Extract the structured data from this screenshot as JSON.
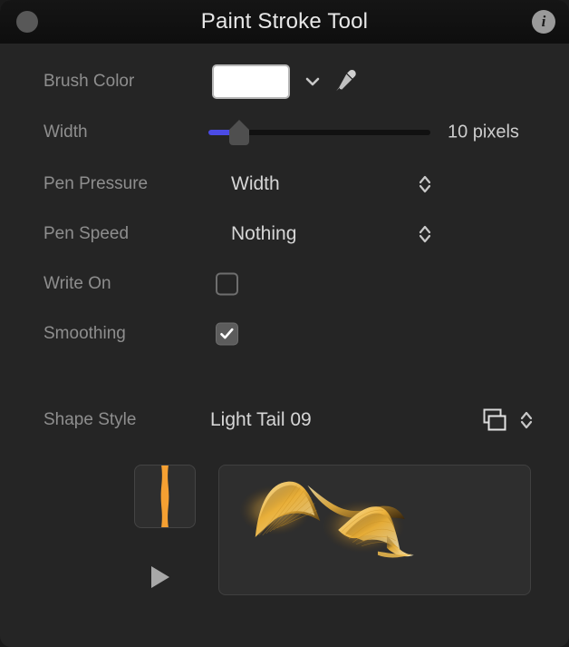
{
  "window": {
    "title": "Paint Stroke Tool",
    "close_label": "",
    "info_label": "i",
    "background_color": "#252525",
    "titlebar_color": "#111111"
  },
  "controls": {
    "brush_color": {
      "label": "Brush Color",
      "swatch_color": "#ffffff",
      "chevron_icon": "chevron-down-icon",
      "picker_icon": "eyedropper-icon"
    },
    "width": {
      "label": "Width",
      "value_text": "10 pixels",
      "value": 10,
      "unit": "pixels",
      "fill_color": "#4b4be6",
      "track_color": "#111111",
      "thumb_color": "#4f4f4f"
    },
    "pen_pressure": {
      "label": "Pen Pressure",
      "value": "Width",
      "stepper_icon": "stepper-updown-icon"
    },
    "pen_speed": {
      "label": "Pen Speed",
      "value": "Nothing",
      "stepper_icon": "stepper-updown-icon"
    },
    "write_on": {
      "label": "Write On",
      "checked": false
    },
    "smoothing": {
      "label": "Smoothing",
      "checked": true
    },
    "shape_style": {
      "label": "Shape Style",
      "value": "Light Tail 09",
      "layers_icon": "stacked-squares-icon",
      "stepper_icon": "stepper-updown-icon"
    }
  },
  "preview": {
    "thumbnail_name": "brush-profile-thumbnail",
    "stroke_color": "#f5a032",
    "play_icon": "play-icon",
    "preview_name": "shape-style-preview",
    "preview_glow_color": "#f2c14a"
  }
}
